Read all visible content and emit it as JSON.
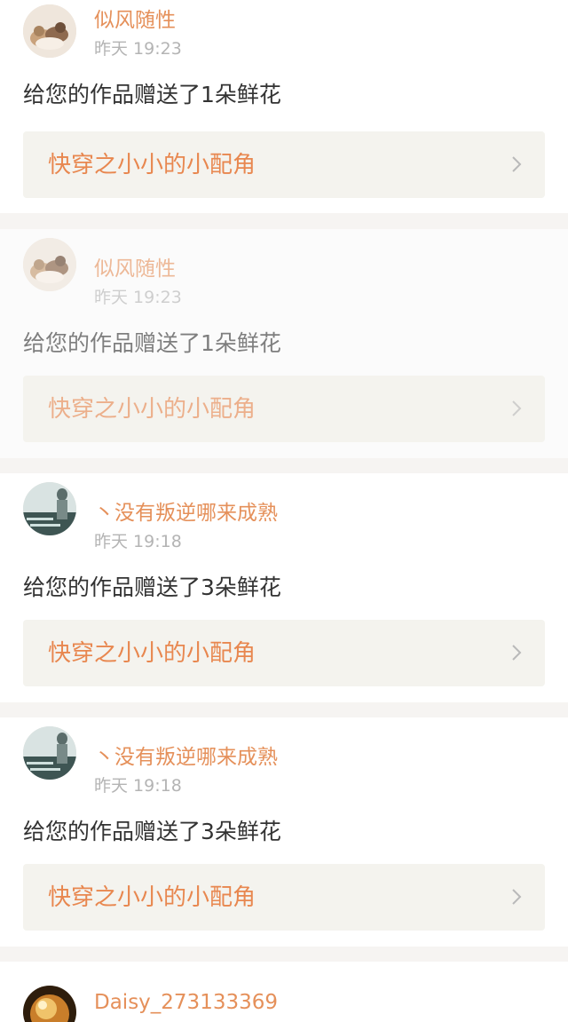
{
  "notifications": [
    {
      "username": "似风随性",
      "timestamp": "昨天 19:23",
      "message": "给您的作品赠送了1朵鲜花",
      "work_title": "快穿之小小的小配角",
      "avatar_icon": "cat-photo-icon",
      "faded": false
    },
    {
      "username": "似风随性",
      "timestamp": "昨天 19:23",
      "message": "给您的作品赠送了1朵鲜花",
      "work_title": "快穿之小小的小配角",
      "avatar_icon": "cat-photo-icon",
      "faded": true
    },
    {
      "username": "丶没有叛逆哪来成熟",
      "timestamp": "昨天 19:18",
      "message": "给您的作品赠送了3朵鲜花",
      "work_title": "快穿之小小的小配角",
      "avatar_icon": "person-photo-icon",
      "faded": false
    },
    {
      "username": "丶没有叛逆哪来成熟",
      "timestamp": "昨天 19:18",
      "message": "给您的作品赠送了3朵鲜花",
      "work_title": "快穿之小小的小配角",
      "avatar_icon": "person-photo-icon",
      "faded": false
    },
    {
      "username": "Daisy_273133369",
      "avatar_icon": "golden-orb-icon",
      "faded": false
    }
  ],
  "colors": {
    "accent": "#e8874f",
    "username": "#e5905a",
    "timestamp": "#b4b4b4",
    "message": "#333333",
    "link_bg": "#f4f3ee",
    "separator": "#f6f4f2"
  }
}
